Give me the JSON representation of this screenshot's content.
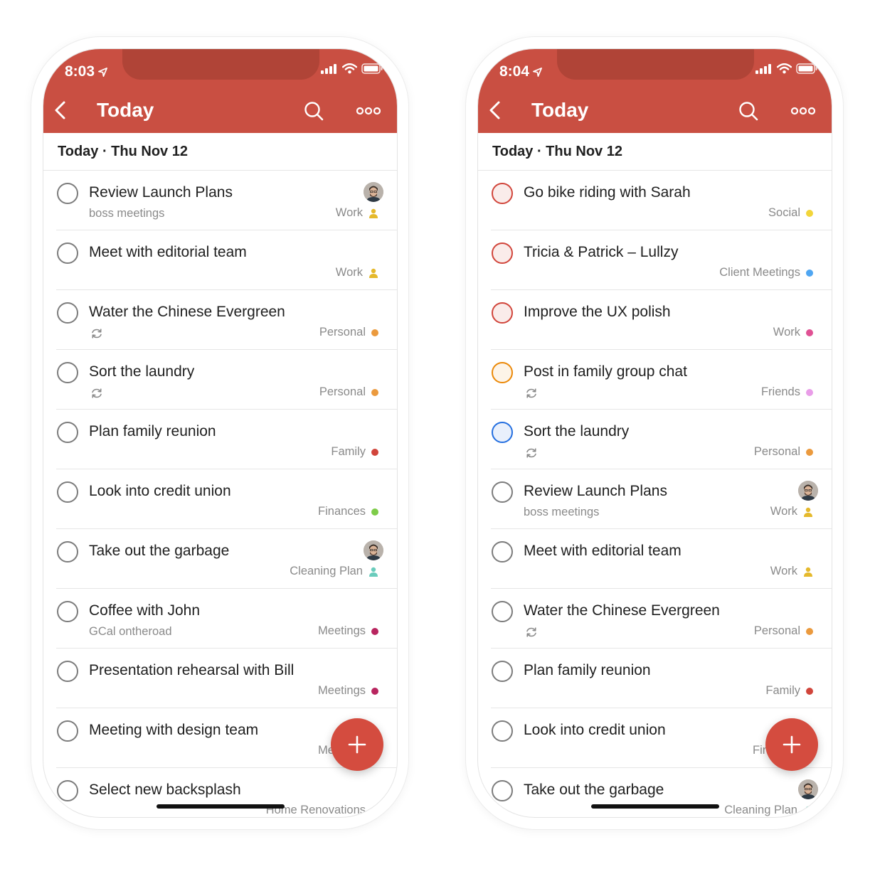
{
  "colors": {
    "header": "#c94f42",
    "fab": "#d44c3f",
    "priority_1": "#d1453b",
    "priority_2": "#eb8909",
    "priority_3": "#246fe0"
  },
  "left": {
    "time": "8:03",
    "title": "Today",
    "date_header": "Today · Thu Nov 12",
    "tasks": [
      {
        "title": "Review Launch Plans",
        "desc": "boss meetings",
        "project": "Work",
        "marker": "person",
        "color": "#e5b92c",
        "avatar": true,
        "recurring": false,
        "priority": 0
      },
      {
        "title": "Meet with editorial team",
        "desc": "",
        "project": "Work",
        "marker": "person",
        "color": "#e5b92c",
        "avatar": false,
        "recurring": false,
        "priority": 0
      },
      {
        "title": "Water the Chinese Evergreen",
        "desc": "",
        "project": "Personal",
        "marker": "dot",
        "color": "#eb9a3e",
        "avatar": false,
        "recurring": true,
        "priority": 0
      },
      {
        "title": "Sort the laundry",
        "desc": "",
        "project": "Personal",
        "marker": "dot",
        "color": "#eb9a3e",
        "avatar": false,
        "recurring": true,
        "priority": 0
      },
      {
        "title": "Plan family reunion",
        "desc": "",
        "project": "Family",
        "marker": "dot",
        "color": "#d1453b",
        "avatar": false,
        "recurring": false,
        "priority": 0
      },
      {
        "title": "Look into credit union",
        "desc": "",
        "project": "Finances",
        "marker": "dot",
        "color": "#7ecc49",
        "avatar": false,
        "recurring": false,
        "priority": 0
      },
      {
        "title": "Take out the garbage",
        "desc": "",
        "project": "Cleaning Plan",
        "marker": "person",
        "color": "#6accbc",
        "avatar": true,
        "recurring": false,
        "priority": 0
      },
      {
        "title": "Coffee with John",
        "desc": "GCal ontheroad",
        "project": "Meetings",
        "marker": "dot",
        "color": "#b8255f",
        "avatar": false,
        "recurring": false,
        "priority": 0
      },
      {
        "title": "Presentation rehearsal with Bill",
        "desc": "",
        "project": "Meetings",
        "marker": "dot",
        "color": "#b8255f",
        "avatar": false,
        "recurring": false,
        "priority": 0
      },
      {
        "title": "Meeting with design team",
        "desc": "",
        "project": "Meetings",
        "marker": "dot",
        "color": "#b8255f",
        "avatar": false,
        "recurring": false,
        "priority": 0
      },
      {
        "title": "Select new backsplash",
        "desc": "",
        "project": "Home Renovations",
        "marker": "dot",
        "color": "#96c3eb",
        "avatar": false,
        "recurring": false,
        "priority": 0
      }
    ]
  },
  "right": {
    "time": "8:04",
    "title": "Today",
    "date_header": "Today · Thu Nov 12",
    "tasks": [
      {
        "title": "Go bike riding with Sarah",
        "desc": "",
        "project": "Social",
        "marker": "dot",
        "color": "#f2d53a",
        "avatar": false,
        "recurring": false,
        "priority": 1
      },
      {
        "title": "Tricia & Patrick – Lullzy",
        "desc": "",
        "project": "Client Meetings",
        "marker": "dot",
        "color": "#4fa6f2",
        "avatar": false,
        "recurring": false,
        "priority": 1
      },
      {
        "title": "Improve the UX polish",
        "desc": "",
        "project": "Work",
        "marker": "dot",
        "color": "#e05194",
        "avatar": false,
        "recurring": false,
        "priority": 1
      },
      {
        "title": "Post in family group chat",
        "desc": "",
        "project": "Friends",
        "marker": "dot",
        "color": "#e99de8",
        "avatar": false,
        "recurring": true,
        "priority": 2
      },
      {
        "title": "Sort the laundry",
        "desc": "",
        "project": "Personal",
        "marker": "dot",
        "color": "#eb9a3e",
        "avatar": false,
        "recurring": true,
        "priority": 3
      },
      {
        "title": "Review Launch Plans",
        "desc": "boss meetings",
        "project": "Work",
        "marker": "person",
        "color": "#e5b92c",
        "avatar": true,
        "recurring": false,
        "priority": 0
      },
      {
        "title": "Meet with editorial team",
        "desc": "",
        "project": "Work",
        "marker": "person",
        "color": "#e5b92c",
        "avatar": false,
        "recurring": false,
        "priority": 0
      },
      {
        "title": "Water the Chinese Evergreen",
        "desc": "",
        "project": "Personal",
        "marker": "dot",
        "color": "#eb9a3e",
        "avatar": false,
        "recurring": true,
        "priority": 0
      },
      {
        "title": "Plan family reunion",
        "desc": "",
        "project": "Family",
        "marker": "dot",
        "color": "#d1453b",
        "avatar": false,
        "recurring": false,
        "priority": 0
      },
      {
        "title": "Look into credit union",
        "desc": "",
        "project": "Finances",
        "marker": "dot",
        "color": "#7ecc49",
        "avatar": false,
        "recurring": false,
        "priority": 0
      },
      {
        "title": "Take out the garbage",
        "desc": "",
        "project": "Cleaning Plan",
        "marker": "person",
        "color": "#6accbc",
        "avatar": true,
        "recurring": false,
        "priority": 0
      }
    ]
  }
}
